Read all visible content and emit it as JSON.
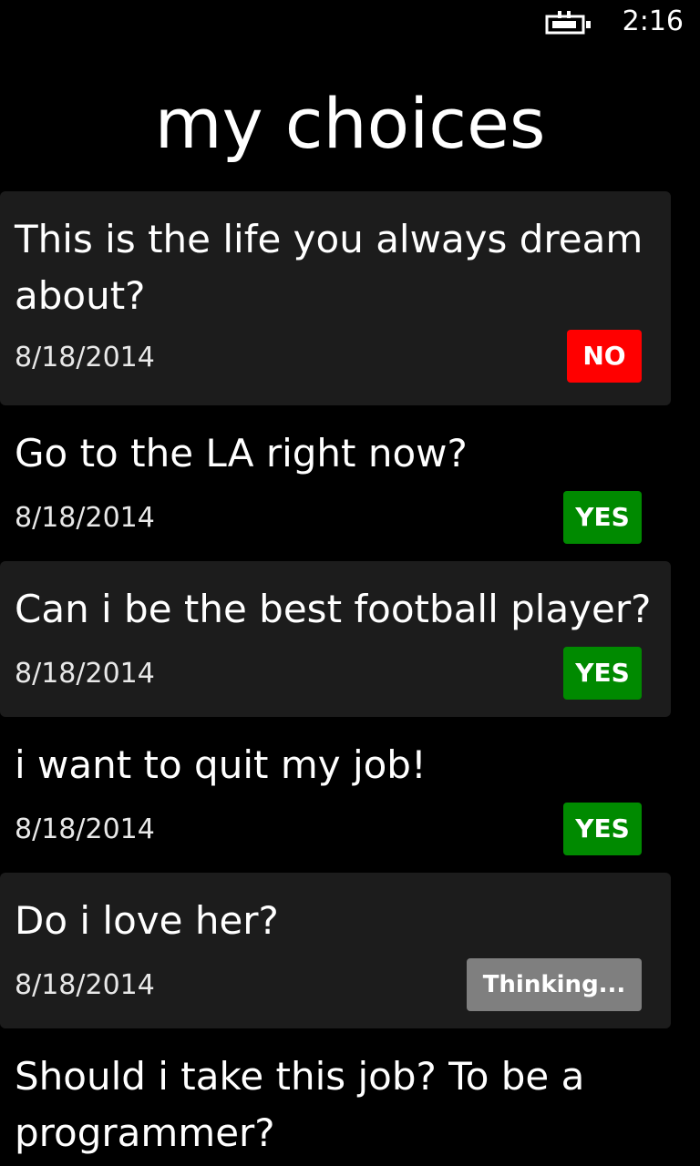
{
  "status_bar": {
    "time": "2:16",
    "battery_icon": "battery-charging-icon"
  },
  "page": {
    "title": "my choices"
  },
  "choices": [
    {
      "question": "This is the life you always dream about?",
      "date": "8/18/2014",
      "answer": "NO",
      "answer_color": "#ff0000"
    },
    {
      "question": "Go to the LA right now?",
      "date": "8/18/2014",
      "answer": "YES",
      "answer_color": "#008a00"
    },
    {
      "question": "Can i be the best football player?",
      "date": "8/18/2014",
      "answer": "YES",
      "answer_color": "#008a00"
    },
    {
      "question": "i want to quit my job!",
      "date": "8/18/2014",
      "answer": "YES",
      "answer_color": "#008a00"
    },
    {
      "question": "Do i love her?",
      "date": "8/18/2014",
      "answer": "Thinking...",
      "answer_color": "#7f7f7f"
    },
    {
      "question": "Should i take this job? To be a programmer?"
    }
  ]
}
